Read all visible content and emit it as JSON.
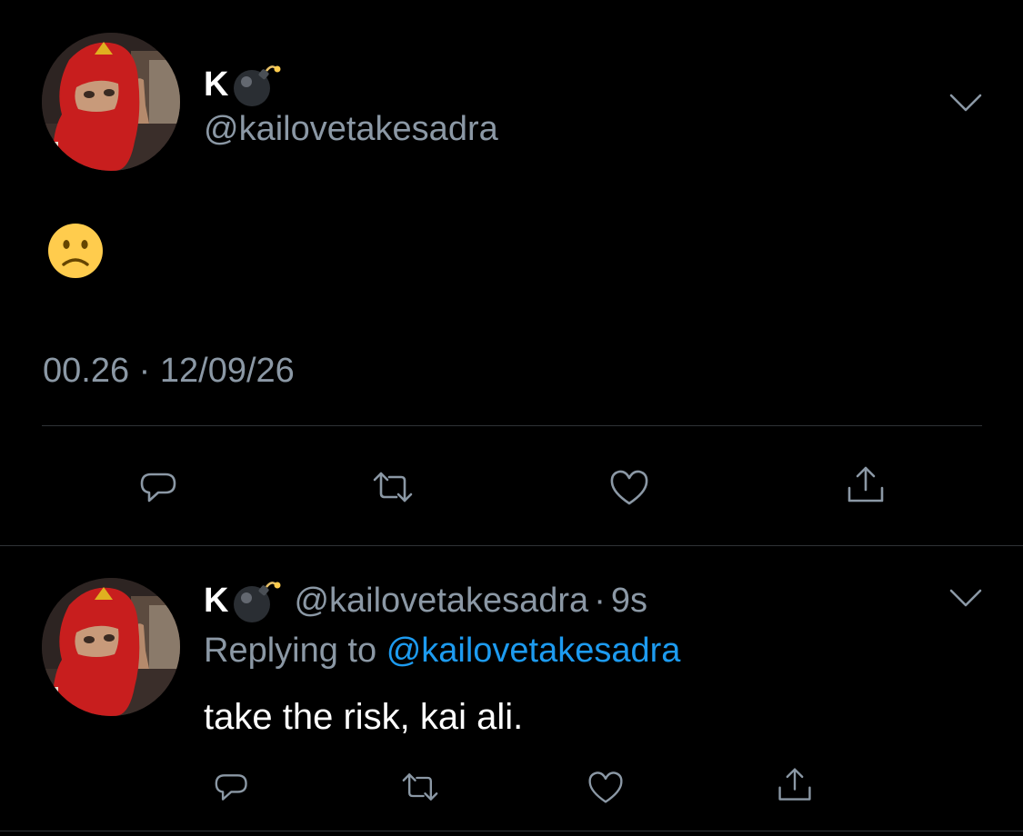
{
  "main_tweet": {
    "display_name": "K",
    "display_emoji": "bomb-icon",
    "handle": "@kailovetakesadra",
    "content_emoji": "slightly-frowning-face-icon",
    "timestamp": "00.26 · 12/09/26"
  },
  "reply_tweet": {
    "display_name": "K",
    "display_emoji": "bomb-icon",
    "handle": "@kailovetakesadra",
    "separator": "·",
    "time_ago": "9s",
    "replying_prefix": "Replying to",
    "replying_handle": "@kailovetakesadra",
    "text": "take the risk, kai ali."
  },
  "actions": [
    "reply-icon",
    "retweet-icon",
    "like-icon",
    "share-icon"
  ],
  "colors": {
    "background": "#000000",
    "muted_text": "#8b98a5",
    "link": "#1d9bf0",
    "divider": "#2f3336"
  }
}
